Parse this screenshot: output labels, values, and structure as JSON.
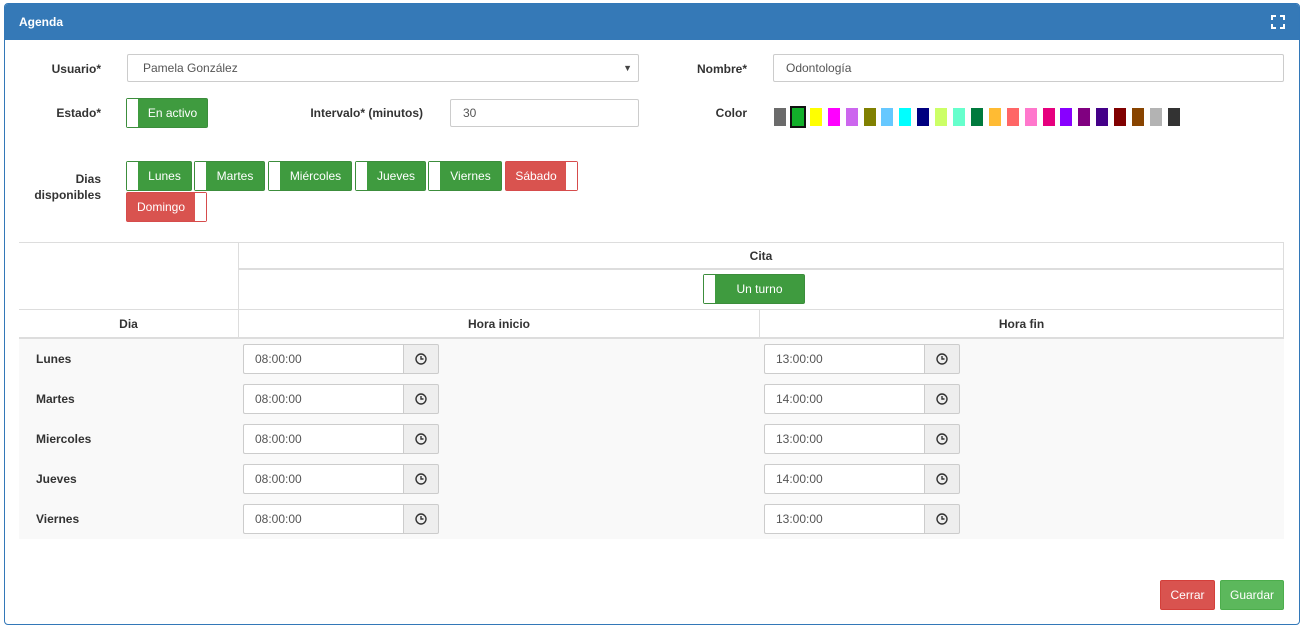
{
  "panel": {
    "title": "Agenda"
  },
  "form": {
    "usuario_label": "Usuario*",
    "usuario_value": "Pamela González",
    "nombre_label": "Nombre*",
    "nombre_value": "Odontología",
    "estado_label": "Estado*",
    "estado_value": "En activo",
    "intervalo_label": "Intervalo* (minutos)",
    "intervalo_value": "30",
    "color_label": "Color",
    "colors": [
      "#6b6b6b",
      "#12b02a",
      "#ffff00",
      "#ff00ff",
      "#cc66ee",
      "#808000",
      "#66c8ff",
      "#00ffff",
      "#000080",
      "#ccff66",
      "#66ffcc",
      "#007a3d",
      "#ffbb33",
      "#ff6666",
      "#ff77cc",
      "#e6007e",
      "#8800ff",
      "#800080",
      "#440088",
      "#800000",
      "#884400",
      "#b3b3b3",
      "#333333"
    ],
    "selected_color_index": 1,
    "dias_label": "Dias disponibles",
    "days": [
      {
        "label": "Lunes",
        "on": true
      },
      {
        "label": "Martes",
        "on": true
      },
      {
        "label": "Miércoles",
        "on": true
      },
      {
        "label": "Jueves",
        "on": true
      },
      {
        "label": "Viernes",
        "on": true
      },
      {
        "label": "Sábado",
        "on": false
      },
      {
        "label": "Domingo",
        "on": false
      }
    ]
  },
  "schedule": {
    "cita_header": "Cita",
    "turno_label": "Un turno",
    "dia_header": "Dia",
    "hora_inicio_header": "Hora inicio",
    "hora_fin_header": "Hora fin",
    "rows": [
      {
        "day": "Lunes",
        "start": "08:00:00",
        "end": "13:00:00"
      },
      {
        "day": "Martes",
        "start": "08:00:00",
        "end": "14:00:00"
      },
      {
        "day": "Miercoles",
        "start": "08:00:00",
        "end": "13:00:00"
      },
      {
        "day": "Jueves",
        "start": "08:00:00",
        "end": "14:00:00"
      },
      {
        "day": "Viernes",
        "start": "08:00:00",
        "end": "13:00:00"
      }
    ]
  },
  "footer": {
    "cerrar_label": "Cerrar",
    "guardar_label": "Guardar"
  }
}
